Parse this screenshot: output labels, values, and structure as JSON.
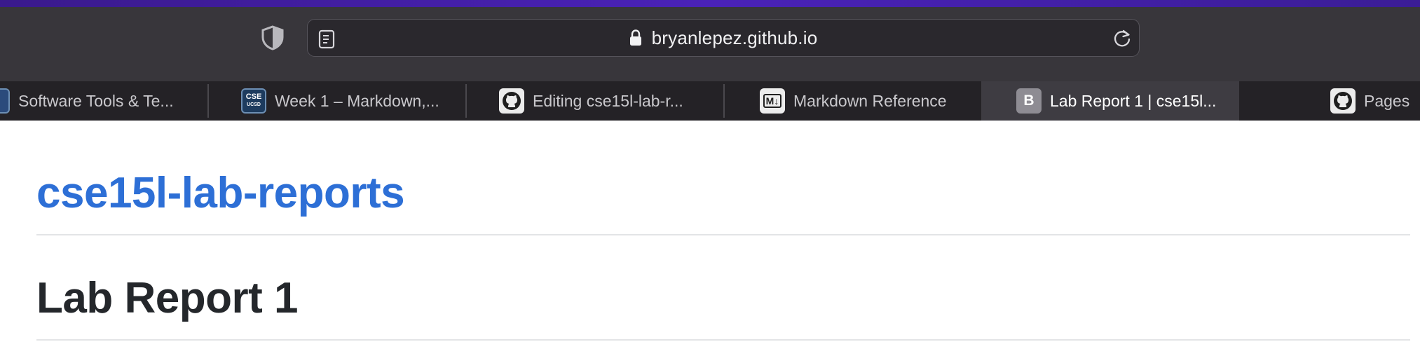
{
  "browser": {
    "address_bar": {
      "url": "bryanlepez.github.io"
    },
    "tabs": [
      {
        "title": "Software Tools & Te...",
        "favicon": "site-favicon",
        "active": false
      },
      {
        "title": "Week 1 – Markdown,...",
        "favicon": "cse-ucsd-favicon",
        "favicon_text": [
          "CSE",
          "UCSD"
        ],
        "active": false
      },
      {
        "title": "Editing cse15l-lab-r...",
        "favicon": "github-favicon",
        "active": false
      },
      {
        "title": "Markdown Reference",
        "favicon": "markdown-favicon",
        "favicon_text": "M↓",
        "active": false
      },
      {
        "title": "Lab Report 1 | cse15l...",
        "favicon": "letter-favicon",
        "favicon_text": "B",
        "active": true
      },
      {
        "title": "Pages",
        "favicon": "github-favicon",
        "active": false
      }
    ],
    "colors": {
      "toolbar": "#38363b",
      "tabstrip": "#242226",
      "active_tab": "#3e3c42",
      "accent_strip": "#4a22b8"
    }
  },
  "page": {
    "site_title": "cse15l-lab-reports",
    "heading": "Lab Report 1",
    "colors": {
      "link": "#2d6fd6",
      "heading": "#24272b"
    }
  }
}
